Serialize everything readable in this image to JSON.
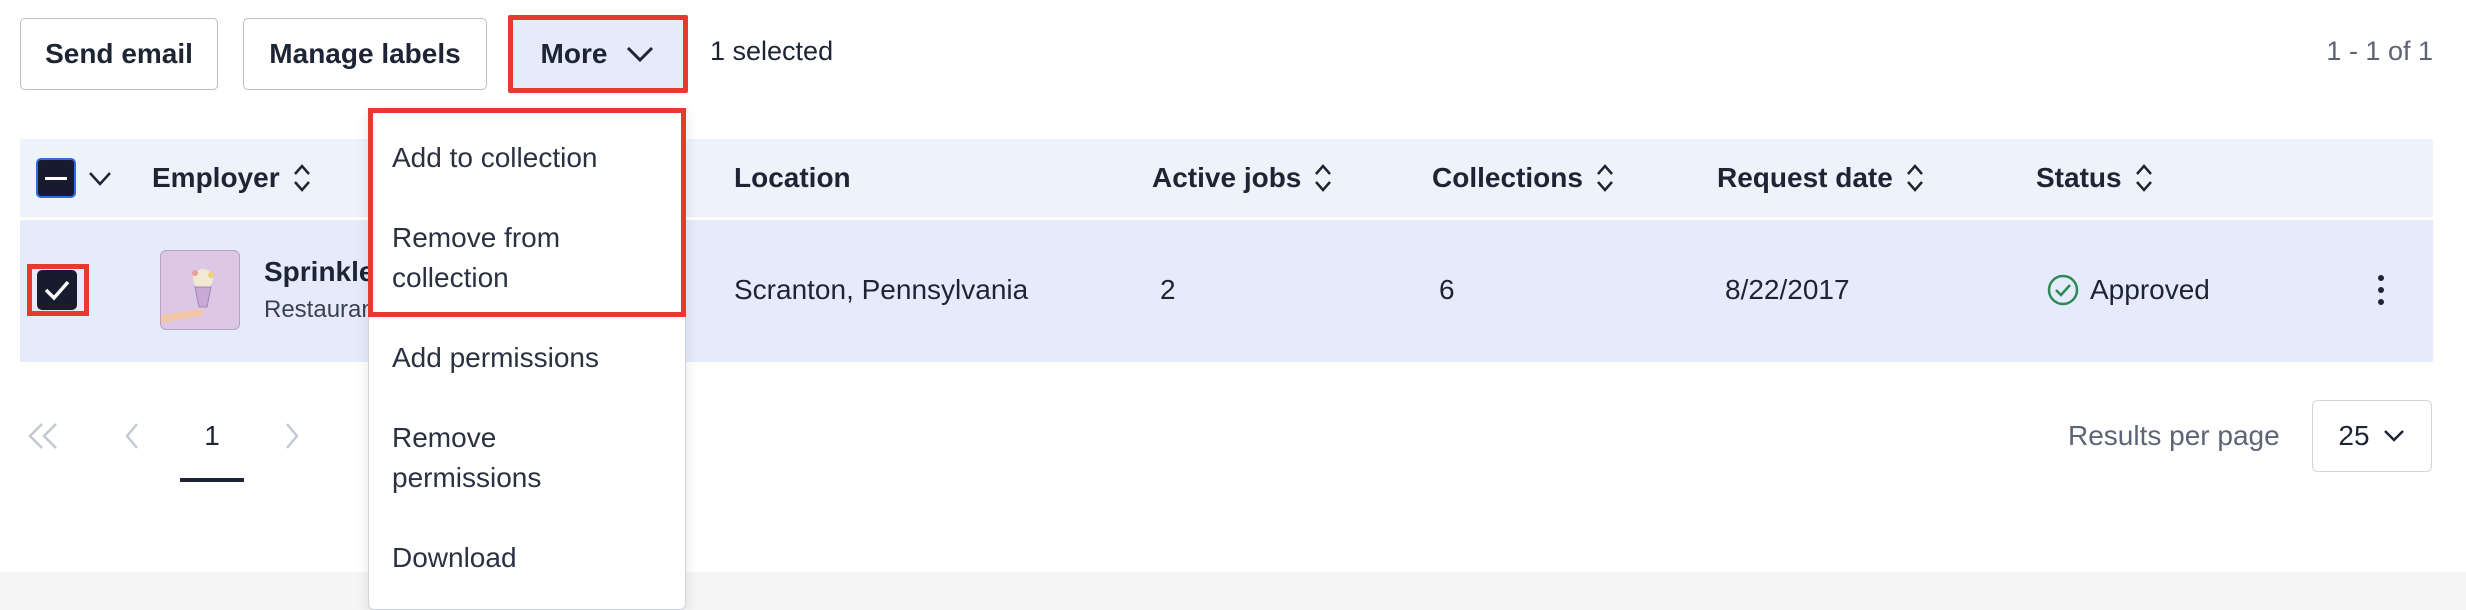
{
  "toolbar": {
    "send_email": "Send email",
    "manage_labels": "Manage labels",
    "more": "More",
    "selected_count": "1 selected",
    "range": "1 - 1 of 1"
  },
  "table": {
    "headers": {
      "employer": "Employer",
      "location": "Location",
      "active_jobs": "Active jobs",
      "collections": "Collections",
      "request_date": "Request date",
      "status": "Status"
    },
    "rows": [
      {
        "employer_name": "Sprinkle",
        "employer_type": "Restaurant",
        "location": "Scranton, Pennsylvania",
        "active_jobs": "2",
        "collections": "6",
        "request_date": "8/22/2017",
        "status": "Approved"
      }
    ]
  },
  "menu": {
    "items": [
      "Add to collection",
      "Remove from collection",
      "Add permissions",
      "Remove permissions",
      "Download"
    ],
    "item_lines": [
      [
        "Add to collection"
      ],
      [
        "Remove from",
        "collection"
      ],
      [
        "Add permissions"
      ],
      [
        "Remove",
        "permissions"
      ],
      [
        "Download"
      ]
    ]
  },
  "pagination": {
    "current_page": "1",
    "results_per_page_label": "Results per page",
    "results_per_page_value": "25"
  },
  "colors": {
    "accent_highlight": "#e63a2e",
    "row_selected": "#e6ebfb",
    "header_bg": "#eef2fb",
    "status_green": "#2e8b57"
  }
}
